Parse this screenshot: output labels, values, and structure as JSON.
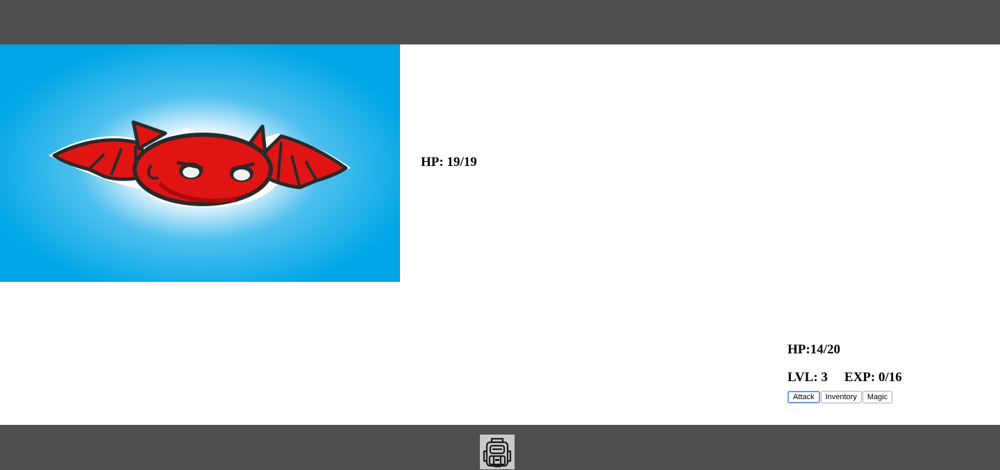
{
  "enemy": {
    "image": "red-bat-monster",
    "hp_text": "HP: 19/19",
    "hp_current": 19,
    "hp_max": 19
  },
  "player": {
    "hp_text": "HP:14/20",
    "hp_current": 14,
    "hp_max": 20,
    "level_text": "LVL: 3",
    "exp_text": "EXP: 0/16"
  },
  "actions": {
    "attack_label": "Attack",
    "inventory_label": "Inventory",
    "magic_label": "Magic"
  },
  "bottom_bar": {
    "icon": "backpack-icon"
  },
  "colors": {
    "bar": "#4f4f4f",
    "sky": "#00a6e6",
    "bat": "#e11414",
    "focus": "#6d9be8"
  }
}
